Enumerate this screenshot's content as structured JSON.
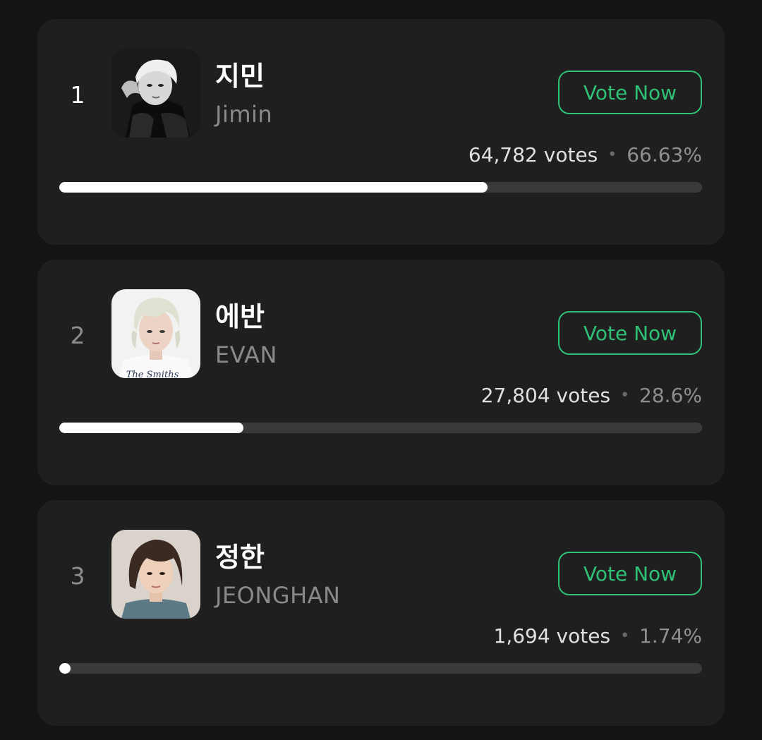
{
  "candidates": [
    {
      "rank": "1",
      "name_ko": "지민",
      "name_en": "Jimin",
      "vote_label": "Vote Now",
      "votes": "64,782 votes",
      "separator": "•",
      "percent": "66.63%",
      "percent_value": 66.63,
      "avatar_icon": "photo-jimin"
    },
    {
      "rank": "2",
      "name_ko": "에반",
      "name_en": "EVAN",
      "vote_label": "Vote Now",
      "votes": "27,804 votes",
      "separator": "•",
      "percent": "28.6%",
      "percent_value": 28.6,
      "avatar_icon": "photo-evan",
      "shirt_text": "The Smiths"
    },
    {
      "rank": "3",
      "name_ko": "정한",
      "name_en": "JEONGHAN",
      "vote_label": "Vote Now",
      "votes": "1,694 votes",
      "separator": "•",
      "percent": "1.74%",
      "percent_value": 1.74,
      "avatar_icon": "photo-jeonghan"
    }
  ],
  "colors": {
    "background": "#141414",
    "card": "#1f1f1f",
    "accent": "#2fc176",
    "bar_fill": "#ffffff",
    "bar_track": "#3a3a3a"
  }
}
